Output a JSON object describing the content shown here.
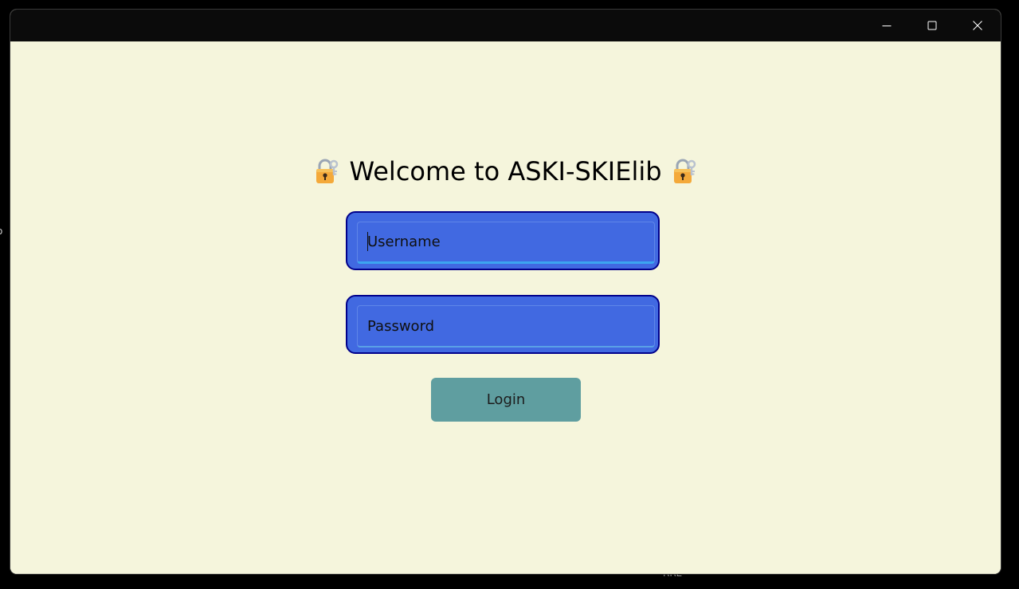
{
  "desktop": {
    "edge_text": "o",
    "bottom_text": "RRE"
  },
  "window": {
    "controls": {
      "minimize_icon": "minimize-icon",
      "maximize_icon": "maximize-icon",
      "close_icon": "close-icon"
    }
  },
  "login": {
    "heading": "Welcome to ASKI-SKIElib",
    "heading_icon": "locked-with-key-icon",
    "username_placeholder": "Username",
    "password_placeholder": "Password",
    "login_label": "Login"
  },
  "colors": {
    "background": "#f5f5dc",
    "titlebar": "#0b0b0b",
    "field_fill": "#4169e1",
    "field_border": "#00008b",
    "focus_underline": "#3ca5f0",
    "button": "#5f9ea0"
  }
}
